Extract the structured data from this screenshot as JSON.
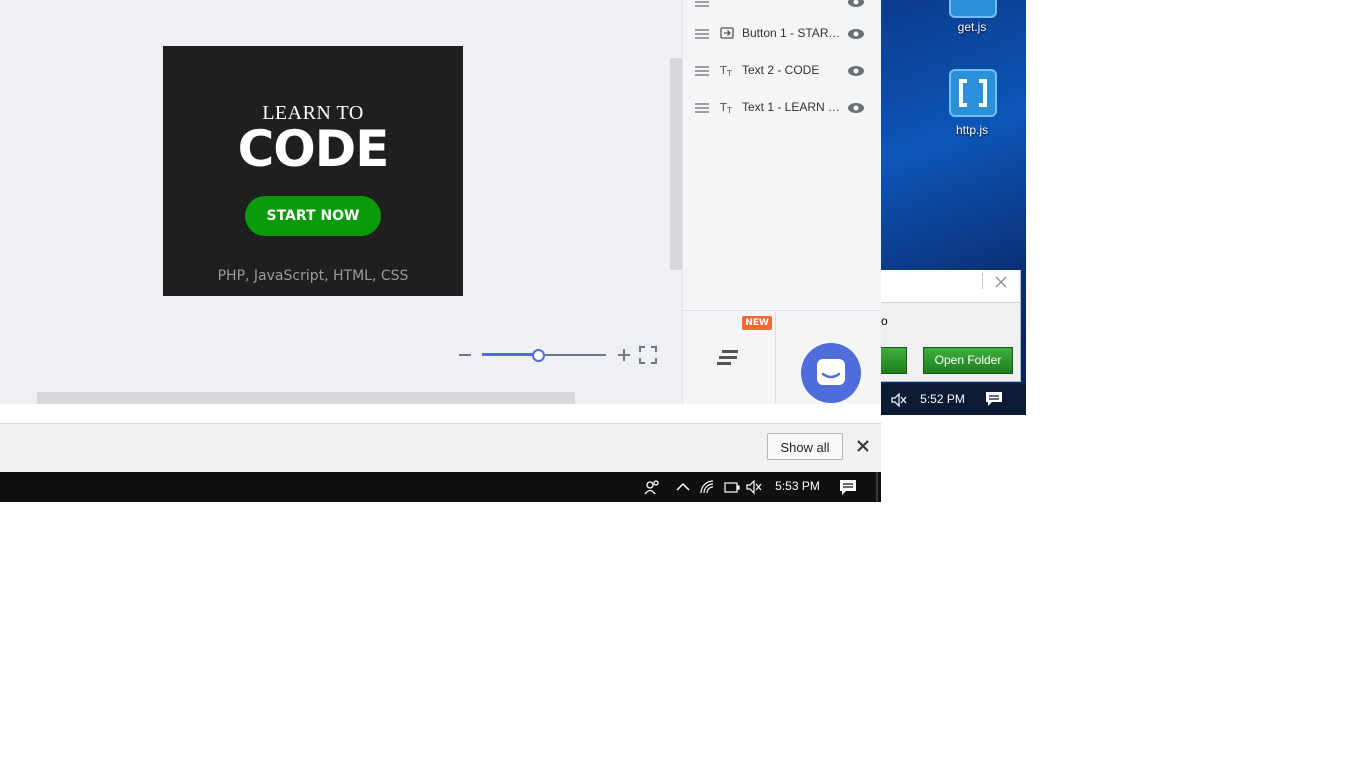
{
  "editor": {
    "banner": {
      "line1": "LEARN TO",
      "line2": "CODE",
      "button": "START NOW",
      "subtitle": "PHP, JavaScript, HTML, CSS"
    },
    "zoom_level_fraction": 0.45
  },
  "layers_panel": {
    "layers": [
      {
        "label": "Button 1 - START NOW",
        "type_icon": "button-layer-icon"
      },
      {
        "label": "Text 2 - CODE",
        "type_icon": "text-layer-icon"
      },
      {
        "label": "Text 1 - LEARN TO",
        "type_icon": "text-layer-icon"
      }
    ],
    "new_badge": "NEW"
  },
  "download_bar": {
    "show_all": "Show all"
  },
  "taskbar": {
    "clock": "5:53 PM"
  },
  "background_desktop": {
    "icons": [
      {
        "label": "get.js"
      },
      {
        "label": "http.js"
      }
    ],
    "dialog": {
      "text": "o",
      "open_folder": "Open Folder"
    },
    "clock": "5:52 PM"
  },
  "colors": {
    "banner_bg": "#1f1f1f",
    "cta_green": "#0a9a0a",
    "accent_blue": "#4f6cdb",
    "badge_orange": "#f06a35"
  }
}
